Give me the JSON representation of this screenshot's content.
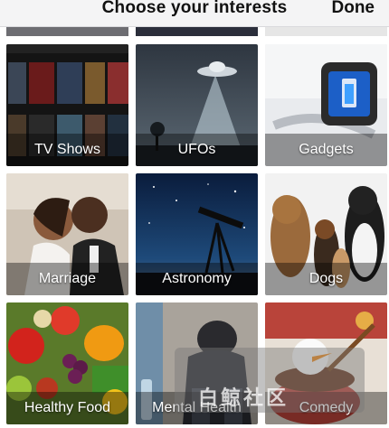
{
  "header": {
    "title": "Choose your interests",
    "done_label": "Done"
  },
  "watermark": {
    "text": "白鲸社区"
  },
  "tiles": [
    {
      "label": "TV Shows",
      "icon": "tv-posters-image"
    },
    {
      "label": "UFOs",
      "icon": "ufo-image"
    },
    {
      "label": "Gadgets",
      "icon": "smartwatch-image"
    },
    {
      "label": "Marriage",
      "icon": "couple-image"
    },
    {
      "label": "Astronomy",
      "icon": "telescope-image"
    },
    {
      "label": "Dogs",
      "icon": "dogs-image"
    },
    {
      "label": "Healthy Food",
      "icon": "vegetables-image"
    },
    {
      "label": "Mental Health",
      "icon": "person-image"
    },
    {
      "label": "Comedy",
      "icon": "snowman-mug-image"
    }
  ]
}
